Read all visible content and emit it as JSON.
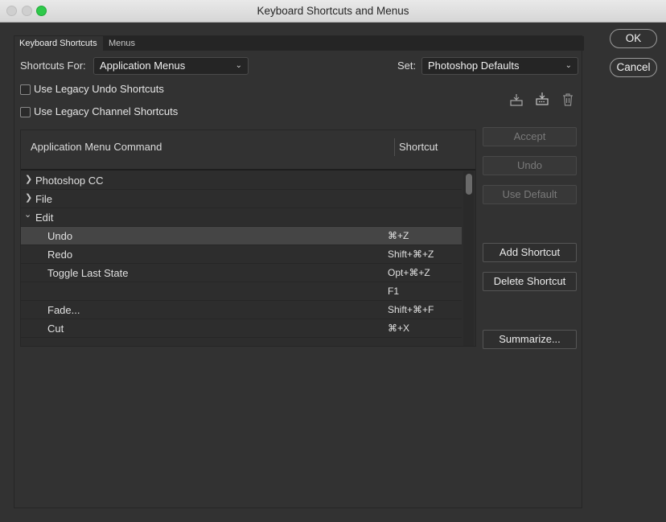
{
  "window": {
    "title": "Keyboard Shortcuts and Menus"
  },
  "tabs": [
    {
      "label": "Keyboard Shortcuts",
      "active": true
    },
    {
      "label": "Menus",
      "active": false
    }
  ],
  "shortcuts_for": {
    "label": "Shortcuts For:",
    "value": "Application Menus"
  },
  "set": {
    "label": "Set:",
    "value": "Photoshop Defaults"
  },
  "checkboxes": [
    {
      "label": "Use Legacy Undo Shortcuts",
      "checked": false
    },
    {
      "label": "Use Legacy Channel Shortcuts",
      "checked": false
    }
  ],
  "icons": [
    "save-set-icon",
    "new-set-icon",
    "delete-set-icon"
  ],
  "table": {
    "header_command": "Application Menu Command",
    "header_shortcut": "Shortcut",
    "rows": [
      {
        "type": "group",
        "expanded": false,
        "command": "Photoshop CC",
        "shortcut": ""
      },
      {
        "type": "group",
        "expanded": false,
        "command": "File",
        "shortcut": ""
      },
      {
        "type": "group",
        "expanded": true,
        "command": "Edit",
        "shortcut": ""
      },
      {
        "type": "item",
        "selected": true,
        "command": "Undo",
        "shortcut": "⌘+Z"
      },
      {
        "type": "item",
        "command": "Redo",
        "shortcut": "Shift+⌘+Z"
      },
      {
        "type": "item",
        "command": "Toggle Last State",
        "shortcut": "Opt+⌘+Z"
      },
      {
        "type": "item",
        "command": "",
        "shortcut": "F1"
      },
      {
        "type": "item",
        "command": "Fade...",
        "shortcut": "Shift+⌘+F"
      },
      {
        "type": "item",
        "command": "Cut",
        "shortcut": "⌘+X"
      }
    ]
  },
  "side_buttons": {
    "accept": "Accept",
    "undo": "Undo",
    "use_default": "Use Default",
    "add_shortcut": "Add Shortcut",
    "delete_shortcut": "Delete Shortcut",
    "summarize": "Summarize..."
  },
  "dialog_buttons": {
    "ok": "OK",
    "cancel": "Cancel"
  },
  "colors": {
    "background": "#323232",
    "titlebar": "#dcdcdc",
    "selected_row": "#454545",
    "zoom_button": "#2ec94a"
  }
}
